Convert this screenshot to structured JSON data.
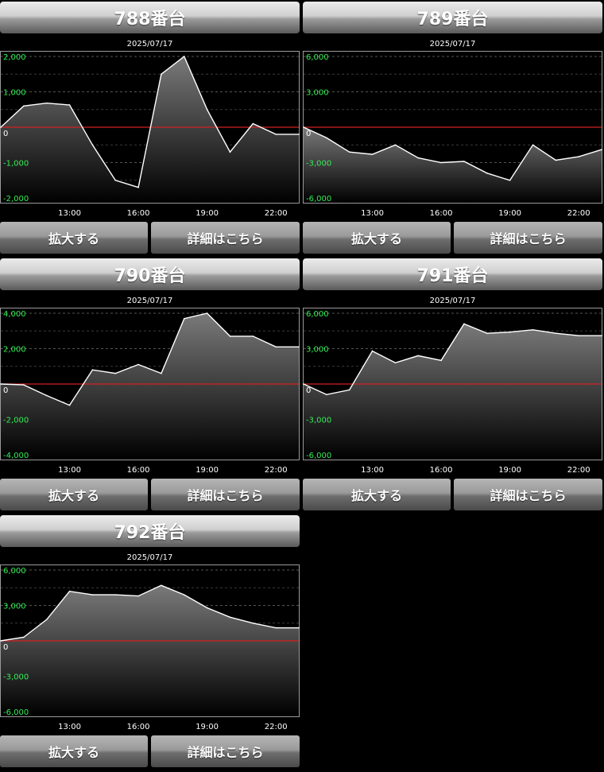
{
  "panels": [
    {
      "title": "788番台",
      "date": "2025/07/17",
      "zoom_label": "拡大する",
      "detail_label": "詳細はこちら",
      "chart_data": {
        "type": "area",
        "x": [
          "10:00",
          "11:00",
          "12:00",
          "13:00",
          "14:00",
          "15:00",
          "16:00",
          "17:00",
          "18:00",
          "19:00",
          "20:00",
          "21:00",
          "22:00",
          "23:00"
        ],
        "values": [
          0,
          600,
          680,
          630,
          -500,
          -1500,
          -1700,
          1500,
          2000,
          500,
          -700,
          100,
          -200,
          -200
        ],
        "ylim": [
          -2000,
          2000
        ],
        "yticks": [
          "2,000",
          "1,000",
          "0",
          "-1,000",
          "-2,000"
        ],
        "yticks_v": [
          2000,
          1000,
          0,
          -1000,
          -2000
        ],
        "xticks": [
          "13:00",
          "16:00",
          "19:00",
          "22:00"
        ]
      }
    },
    {
      "title": "789番台",
      "date": "2025/07/17",
      "zoom_label": "拡大する",
      "detail_label": "詳細はこちら",
      "chart_data": {
        "type": "area",
        "x": [
          "10:00",
          "11:00",
          "12:00",
          "13:00",
          "14:00",
          "15:00",
          "16:00",
          "17:00",
          "18:00",
          "19:00",
          "20:00",
          "21:00",
          "22:00",
          "23:00"
        ],
        "values": [
          0,
          -900,
          -2100,
          -2300,
          -1500,
          -2600,
          -3000,
          -2900,
          -3900,
          -4500,
          -1500,
          -2800,
          -2500,
          -1900
        ],
        "ylim": [
          -6000,
          6000
        ],
        "yticks": [
          "6,000",
          "3,000",
          "0",
          "-3,000",
          "-6,000"
        ],
        "yticks_v": [
          6000,
          3000,
          0,
          -3000,
          -6000
        ],
        "xticks": [
          "13:00",
          "16:00",
          "19:00",
          "22:00"
        ]
      }
    },
    {
      "title": "790番台",
      "date": "2025/07/17",
      "zoom_label": "拡大する",
      "detail_label": "詳細はこちら",
      "chart_data": {
        "type": "area",
        "x": [
          "10:00",
          "11:00",
          "12:00",
          "13:00",
          "14:00",
          "15:00",
          "16:00",
          "17:00",
          "18:00",
          "19:00",
          "20:00",
          "21:00",
          "22:00",
          "23:00"
        ],
        "values": [
          0,
          -50,
          -650,
          -1200,
          800,
          600,
          1100,
          600,
          3700,
          4000,
          2700,
          2700,
          2100,
          2100
        ],
        "ylim": [
          -4000,
          4000
        ],
        "yticks": [
          "4,000",
          "2,000",
          "0",
          "-2,000",
          "-4,000"
        ],
        "yticks_v": [
          4000,
          2000,
          0,
          -2000,
          -4000
        ],
        "xticks": [
          "13:00",
          "16:00",
          "19:00",
          "22:00"
        ]
      }
    },
    {
      "title": "791番台",
      "date": "2025/07/17",
      "zoom_label": "拡大する",
      "detail_label": "詳細はこちら",
      "chart_data": {
        "type": "area",
        "x": [
          "10:00",
          "11:00",
          "12:00",
          "13:00",
          "14:00",
          "15:00",
          "16:00",
          "17:00",
          "18:00",
          "19:00",
          "20:00",
          "21:00",
          "22:00",
          "23:00"
        ],
        "values": [
          0,
          -900,
          -500,
          2800,
          1800,
          2400,
          2000,
          5100,
          4300,
          4400,
          4600,
          4300,
          4100,
          4100
        ],
        "ylim": [
          -6000,
          6000
        ],
        "yticks": [
          "6,000",
          "3,000",
          "0",
          "-3,000",
          "-6,000"
        ],
        "yticks_v": [
          6000,
          3000,
          0,
          -3000,
          -6000
        ],
        "xticks": [
          "13:00",
          "16:00",
          "19:00",
          "22:00"
        ]
      }
    },
    {
      "title": "792番台",
      "date": "2025/07/17",
      "zoom_label": "拡大する",
      "detail_label": "詳細はこちら",
      "chart_data": {
        "type": "area",
        "x": [
          "10:00",
          "11:00",
          "12:00",
          "13:00",
          "14:00",
          "15:00",
          "16:00",
          "17:00",
          "18:00",
          "19:00",
          "20:00",
          "21:00",
          "22:00",
          "23:00"
        ],
        "values": [
          0,
          300,
          1800,
          4200,
          3900,
          3900,
          3800,
          4700,
          3900,
          2800,
          2000,
          1500,
          1100,
          1100
        ],
        "ylim": [
          -6000,
          6000
        ],
        "yticks": [
          "6,000",
          "3,000",
          "0",
          "-3,000",
          "-6,000"
        ],
        "yticks_v": [
          6000,
          3000,
          0,
          -3000,
          -6000
        ],
        "xticks": [
          "13:00",
          "16:00",
          "19:00",
          "22:00"
        ]
      }
    }
  ],
  "colors": {
    "line": "#ffffff",
    "zero_line": "#d42020",
    "y_tick": "#33ee55",
    "x_tick": "#ffffff",
    "zero_tick": "#ffffff"
  }
}
